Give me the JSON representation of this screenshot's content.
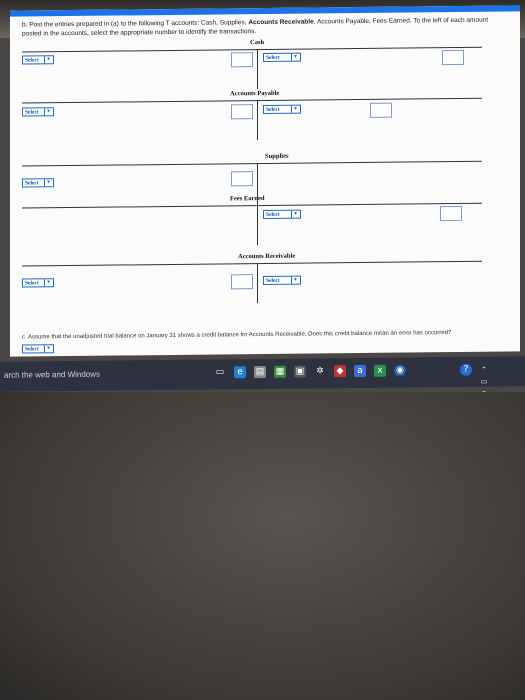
{
  "instructions": {
    "prefix": "b. Post the entries prepared in (a) to the following T accounts: Cash, Supplies,",
    "bold_part": "Accounts Receivable",
    "suffix": ", Accounts Payable, Fees Earned. To the left of each amount posted in the accounts, select the appropriate number to identify the transactions."
  },
  "accounts": {
    "cash": "Cash",
    "accounts_payable": "Accounts Payable",
    "supplies": "Supplies",
    "fees_earned": "Fees Earned",
    "accounts_receivable": "Accounts Receivable"
  },
  "select_label": "Select",
  "question_c": "c. Assume that the unadjusted trial balance on January 31 shows a credit balance for Accounts Receivable. Does this credit balance mean an error has occurred?",
  "taskbar": {
    "search_text": "arch the web and Windows"
  },
  "colors": {
    "accent": "#1a73e8",
    "taskbar": "#2e3140"
  }
}
